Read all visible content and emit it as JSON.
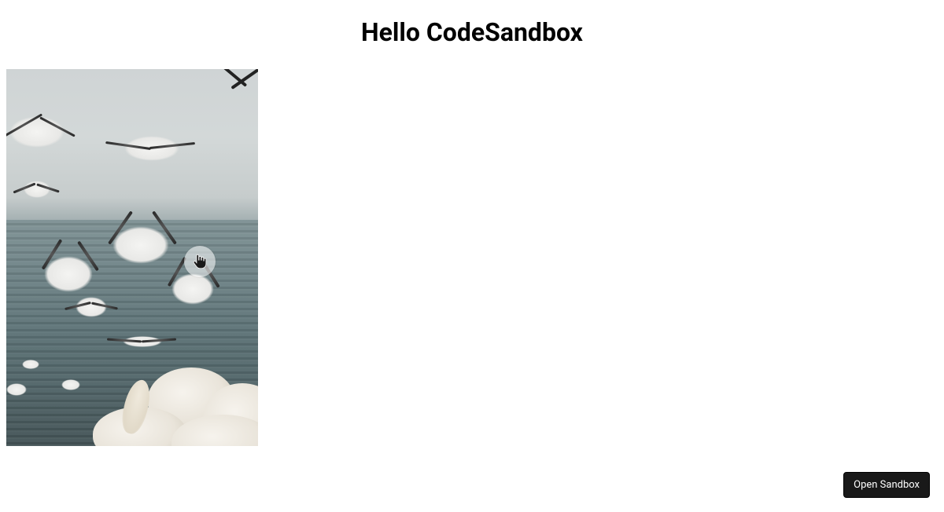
{
  "header": {
    "title": "Hello CodeSandbox"
  },
  "image": {
    "alt": "birds-over-water",
    "cursor_icon": "pointer-hand-icon"
  },
  "footer": {
    "open_sandbox_label": "Open Sandbox"
  }
}
